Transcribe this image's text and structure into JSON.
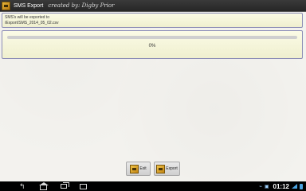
{
  "app": {
    "title": "SMS Export",
    "credit": "created by: Digby Prior"
  },
  "info": {
    "line1": "SMS's will be exported to",
    "line2": "/Export/SMS_2014_05_02.csv"
  },
  "progress": {
    "value": 0,
    "label": "0%"
  },
  "buttons": {
    "exit_label": "Exit",
    "export_label": "Export"
  },
  "statusbar": {
    "time": "01:12"
  },
  "colors": {
    "panel_bg": "#f6f6dc",
    "panel_border": "#8c8db6",
    "actionbar_bg": "#2e2e2e",
    "icon_accent": "#e0a52a"
  },
  "icons": {
    "app": "sms-export-app-icon",
    "exit": "exit-icon",
    "export": "export-icon",
    "back": "back-icon",
    "home": "home-icon",
    "recent": "recent-apps-icon",
    "screenshot": "screenshot-icon"
  }
}
